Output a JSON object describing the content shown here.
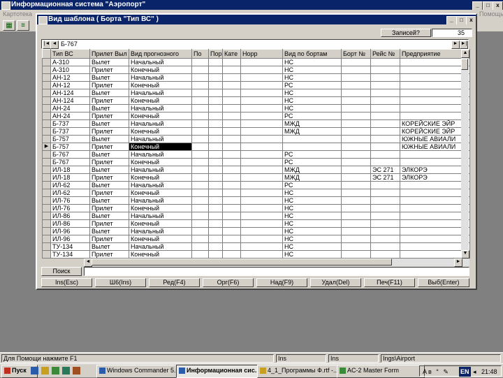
{
  "main_window": {
    "title": "Информационная система \"Аэропорт\"",
    "menu_left": "Картотека",
    "menu_right": "Помощь"
  },
  "dialog": {
    "title": "Вид шаблона ( Борта \"Тип ВС\" )",
    "record_label": "Записей?",
    "record_count": "35",
    "navigator_value": "Б-767"
  },
  "grid": {
    "columns": [
      "Тип ВС",
      "Прилет Выл",
      "Вид прогнозного",
      "По",
      "Пор",
      "Кате",
      "Норр",
      "Вид по бортам",
      "Борт №",
      "Рейс №",
      "Предприятие"
    ],
    "selected_row": 11,
    "rows": [
      [
        "А-310",
        "Вылет",
        "Начальный",
        "",
        "",
        "",
        "",
        "НС",
        "",
        "",
        ""
      ],
      [
        "А-310",
        "Прилет",
        "Конечный",
        "",
        "",
        "",
        "",
        "НС",
        "",
        "",
        ""
      ],
      [
        "АН-12",
        "Вылет",
        "Начальный",
        "",
        "",
        "",
        "",
        "НС",
        "",
        "",
        ""
      ],
      [
        "АН-12",
        "Прилет",
        "Конечный",
        "",
        "",
        "",
        "",
        "РС",
        "",
        "",
        ""
      ],
      [
        "АН-124",
        "Вылет",
        "Начальный",
        "",
        "",
        "",
        "",
        "НС",
        "",
        "",
        ""
      ],
      [
        "АН-124",
        "Прилет",
        "Конечный",
        "",
        "",
        "",
        "",
        "НС",
        "",
        "",
        ""
      ],
      [
        "АН-24",
        "Вылет",
        "Начальный",
        "",
        "",
        "",
        "",
        "НС",
        "",
        "",
        ""
      ],
      [
        "АН-24",
        "Прилет",
        "Конечный",
        "",
        "",
        "",
        "",
        "РС",
        "",
        "",
        ""
      ],
      [
        "Б-737",
        "Вылет",
        "Начальный",
        "",
        "",
        "",
        "",
        "МЖД",
        "",
        "",
        "КОРЕЙСКИЕ ЭЙР"
      ],
      [
        "Б-737",
        "Прилет",
        "Конечный",
        "",
        "",
        "",
        "",
        "МЖД",
        "",
        "",
        "КОРЕЙСКИЕ ЭЙР"
      ],
      [
        "Б-757",
        "Вылет",
        "Начальный",
        "",
        "",
        "",
        "",
        "",
        "",
        "",
        "ЮЖНЫЕ АВИАЛИ"
      ],
      [
        "Б-757",
        "Прилет",
        "Конечный",
        "",
        "",
        "",
        "",
        "",
        "",
        "",
        "ЮЖНЫЕ АВИАЛИ"
      ],
      [
        "Б-767",
        "Вылет",
        "Начальный",
        "",
        "",
        "",
        "",
        "РС",
        "",
        "",
        ""
      ],
      [
        "Б-767",
        "Прилет",
        "Конечный",
        "",
        "",
        "",
        "",
        "РС",
        "",
        "",
        ""
      ],
      [
        "ИЛ-18",
        "Вылет",
        "Начальный",
        "",
        "",
        "",
        "",
        "МЖД",
        "",
        "ЭС 271",
        "ЭЛКОРЭ"
      ],
      [
        "ИЛ-18",
        "Прилет",
        "Конечный",
        "",
        "",
        "",
        "",
        "МЖД",
        "",
        "ЭС 271",
        "ЭЛКОРЭ"
      ],
      [
        "ИЛ-62",
        "Вылет",
        "Начальный",
        "",
        "",
        "",
        "",
        "РС",
        "",
        "",
        ""
      ],
      [
        "ИЛ-62",
        "Прилет",
        "Конечный",
        "",
        "",
        "",
        "",
        "НС",
        "",
        "",
        ""
      ],
      [
        "ИЛ-76",
        "Вылет",
        "Начальный",
        "",
        "",
        "",
        "",
        "НС",
        "",
        "",
        ""
      ],
      [
        "ИЛ-76",
        "Прилет",
        "Конечный",
        "",
        "",
        "",
        "",
        "НС",
        "",
        "",
        ""
      ],
      [
        "ИЛ-86",
        "Вылет",
        "Начальный",
        "",
        "",
        "",
        "",
        "НС",
        "",
        "",
        ""
      ],
      [
        "ИЛ-86",
        "Прилет",
        "Конечный",
        "",
        "",
        "",
        "",
        "НС",
        "",
        "",
        ""
      ],
      [
        "ИЛ-96",
        "Вылет",
        "Начальный",
        "",
        "",
        "",
        "",
        "НС",
        "",
        "",
        ""
      ],
      [
        "ИЛ-96",
        "Прилет",
        "Конечный",
        "",
        "",
        "",
        "",
        "НС",
        "",
        "",
        ""
      ],
      [
        "ТУ-134",
        "Вылет",
        "Начальный",
        "",
        "",
        "",
        "",
        "НС",
        "",
        "",
        ""
      ],
      [
        "ТУ-134",
        "Прилет",
        "Конечный",
        "",
        "",
        "",
        "",
        "НС",
        "",
        "",
        ""
      ]
    ]
  },
  "search": {
    "label": "Поиск",
    "value": ""
  },
  "buttons": [
    "Ins(Esc)",
    "Ш6(Ins)",
    "Ред(F4)",
    "Орг(F6)",
    "Над(F9)",
    "Удал(Del)",
    "Печ(F11)",
    "Выб(Enter)"
  ],
  "status_bar": {
    "hint": "Для Помощи нажмите F1",
    "panel2": "Ins",
    "panel3": "Ins",
    "panel4": "Ings\\Airport"
  },
  "taskbar": {
    "start": "Пуск",
    "tasks": [
      "Windows Commander 5.0...",
      "Информационная сис...",
      "4_1_Программы Ф.rtf -...",
      "AC-2 Master Form"
    ],
    "active_task": 1,
    "lang": "EN",
    "clock": "21:48"
  },
  "colors": {
    "title_active": "#0a246a",
    "face": "#d4d0c8",
    "desktop": "#808080"
  }
}
